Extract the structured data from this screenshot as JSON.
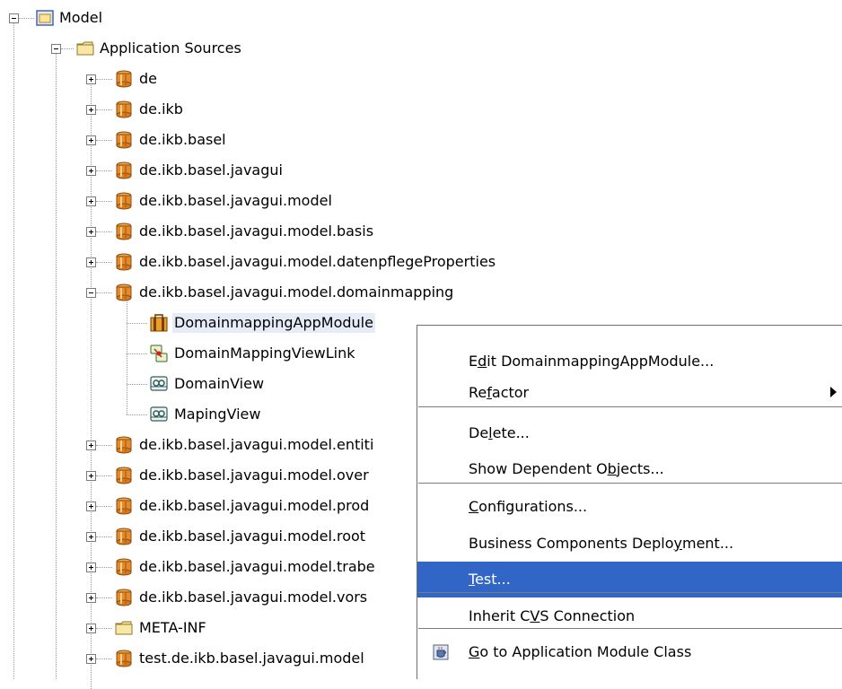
{
  "tree": {
    "root": {
      "label": "Model"
    },
    "app_sources": {
      "label": "Application Sources"
    },
    "packages": [
      {
        "label": "de"
      },
      {
        "label": "de.ikb"
      },
      {
        "label": "de.ikb.basel"
      },
      {
        "label": "de.ikb.basel.javagui"
      },
      {
        "label": "de.ikb.basel.javagui.model"
      },
      {
        "label": "de.ikb.basel.javagui.model.basis"
      },
      {
        "label": "de.ikb.basel.javagui.model.datenpflegeProperties"
      },
      {
        "label": "de.ikb.basel.javagui.model.domainmapping"
      }
    ],
    "domainmapping_children": [
      {
        "label": "DomainmappingAppModule",
        "icon": "app-module-icon"
      },
      {
        "label": "DomainMappingViewLink",
        "icon": "view-link-icon"
      },
      {
        "label": "DomainView",
        "icon": "view-object-icon"
      },
      {
        "label": "MapingView",
        "icon": "view-object-icon"
      }
    ],
    "packages_after": [
      {
        "label": "de.ikb.basel.javagui.model.entiti"
      },
      {
        "label": "de.ikb.basel.javagui.model.over"
      },
      {
        "label": "de.ikb.basel.javagui.model.prod"
      },
      {
        "label": "de.ikb.basel.javagui.model.root"
      },
      {
        "label": "de.ikb.basel.javagui.model.trabe"
      },
      {
        "label": "de.ikb.basel.javagui.model.vors"
      }
    ],
    "meta_inf": {
      "label": "META-INF"
    },
    "test_package": {
      "label": "test.de.ikb.basel.javagui.model"
    }
  },
  "context_menu": {
    "items": [
      {
        "label": "Edit DomainmappingAppModule...",
        "mnemonic": "d"
      },
      {
        "label": "Refactor",
        "mnemonic": "f",
        "submenu": true
      },
      {
        "label": "Delete...",
        "mnemonic": "l"
      },
      {
        "label": "Show Dependent Objects...",
        "mnemonic": "b"
      },
      {
        "label": "Configurations...",
        "mnemonic": "C"
      },
      {
        "label": "Business Components Deployment...",
        "mnemonic": "y"
      },
      {
        "label": "Test...",
        "mnemonic": "T"
      },
      {
        "label": "Inherit CVS Connection",
        "mnemonic": "V"
      },
      {
        "label": "Go to Application Module Class",
        "mnemonic": "G"
      }
    ],
    "active_item": "Test...",
    "active_color": "#3166c7"
  }
}
